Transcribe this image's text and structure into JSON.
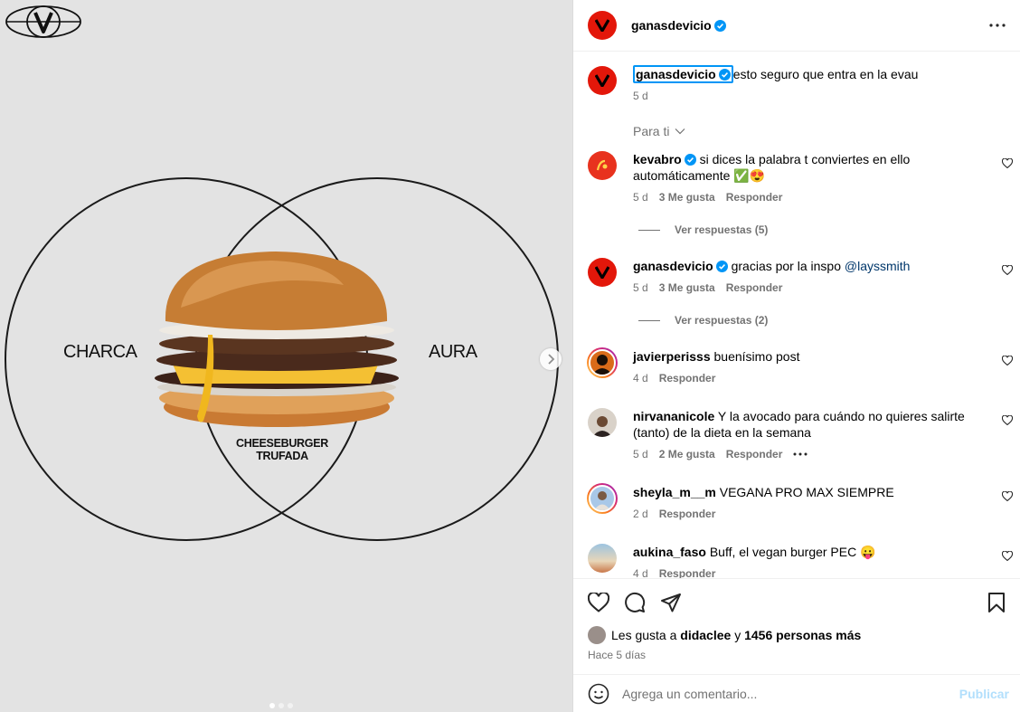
{
  "post": {
    "username": "ganasdevicio",
    "image": {
      "left_label": "CHARCA",
      "right_label": "AURA",
      "center_label_line1": "CHEESEBURGER",
      "center_label_line2": "TRUFADA",
      "carousel_total": 3,
      "carousel_current": 1
    }
  },
  "caption": {
    "username": "ganasdevicio",
    "text": "esto seguro que entra en la evau",
    "time": "5 d"
  },
  "sort": {
    "label": "Para ti"
  },
  "comments": [
    {
      "username": "kevabro",
      "text": "si dices la palabra t conviertes en ello automáticamente ✅😍",
      "time": "5 d",
      "likes": "3 Me gusta",
      "reply": "Responder",
      "replies": "Ver respuestas (5)"
    },
    {
      "username": "ganasdevicio",
      "text": "gracias por la inspo ",
      "mention": "@layssmith",
      "time": "5 d",
      "likes": "3 Me gusta",
      "reply": "Responder",
      "replies": "Ver respuestas (2)"
    },
    {
      "username": "javierperisss",
      "text": "buenísimo post",
      "time": "4 d",
      "reply": "Responder"
    },
    {
      "username": "nirvananicole",
      "text": "Y la avocado para cuándo no quieres salirte (tanto) de la dieta en la semana",
      "time": "5 d",
      "likes": "2 Me gusta",
      "reply": "Responder"
    },
    {
      "username": "sheyla_m__m",
      "text": "VEGANA PRO MAX SIEMPRE",
      "time": "2 d",
      "reply": "Responder"
    },
    {
      "username": "aukina_faso",
      "text": "Buff, el vegan burger PEC 😛",
      "time": "4 d",
      "reply": "Responder"
    }
  ],
  "likes": {
    "prefix": "Les gusta a ",
    "user": "didaclee",
    "connector": " y ",
    "others": "1456 personas más"
  },
  "posted": "Hace 5 días",
  "comment_input": {
    "placeholder": "Agrega un comentario...",
    "publish": "Publicar"
  },
  "colors": {
    "brand_red": "#e3170a",
    "link": "#0095f6",
    "publish_disabled": "#b2dffc",
    "muted": "#737373"
  }
}
